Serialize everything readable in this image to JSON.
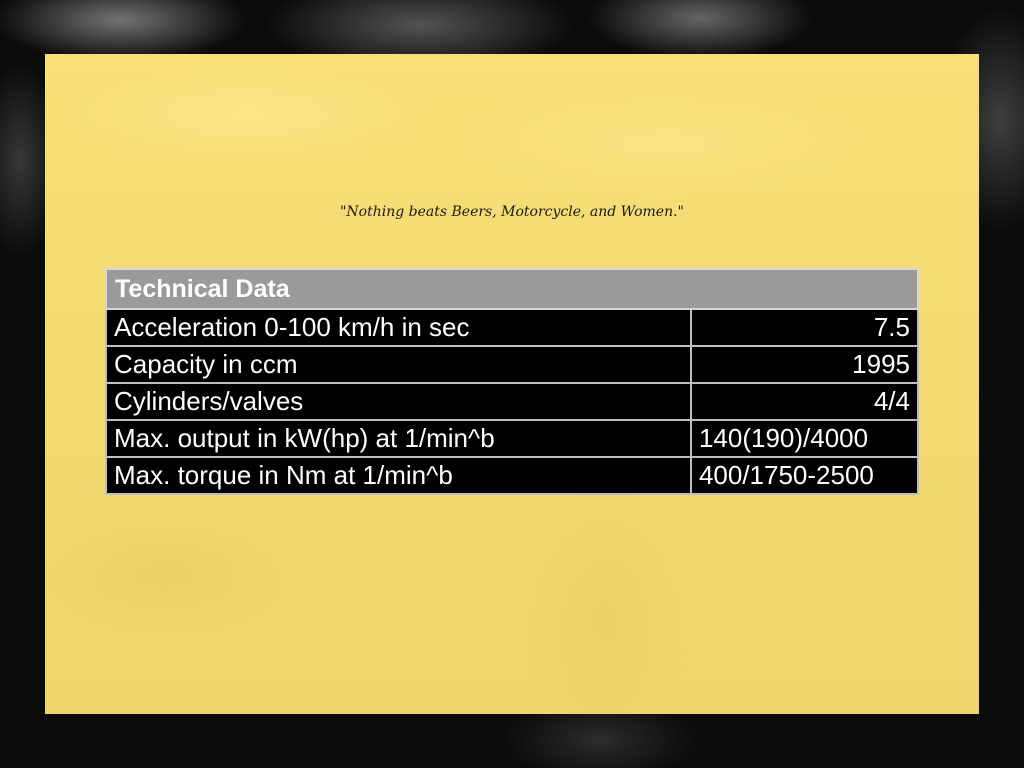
{
  "quote": "\"Nothing beats Beers, Motorcycle, and Women.\"",
  "table": {
    "title": "Technical Data",
    "rows": [
      {
        "label": "Acceleration 0-100 km/h in sec",
        "value": "7.5",
        "align": "right"
      },
      {
        "label": "Capacity in ccm",
        "value": "1995",
        "align": "right"
      },
      {
        "label": "Cylinders/valves",
        "value": "4/4",
        "align": "right"
      },
      {
        "label": "Max. output in kW(hp) at 1/min^b",
        "value": "140(190)/4000",
        "align": "left"
      },
      {
        "label": "Max. torque in Nm at 1/min^b",
        "value": "400/1750-2500",
        "align": "left"
      }
    ]
  },
  "colors": {
    "panel": "#f4da72",
    "table_header": "#9a9a9a",
    "table_cell": "#000000",
    "table_text": "#ffffff"
  }
}
